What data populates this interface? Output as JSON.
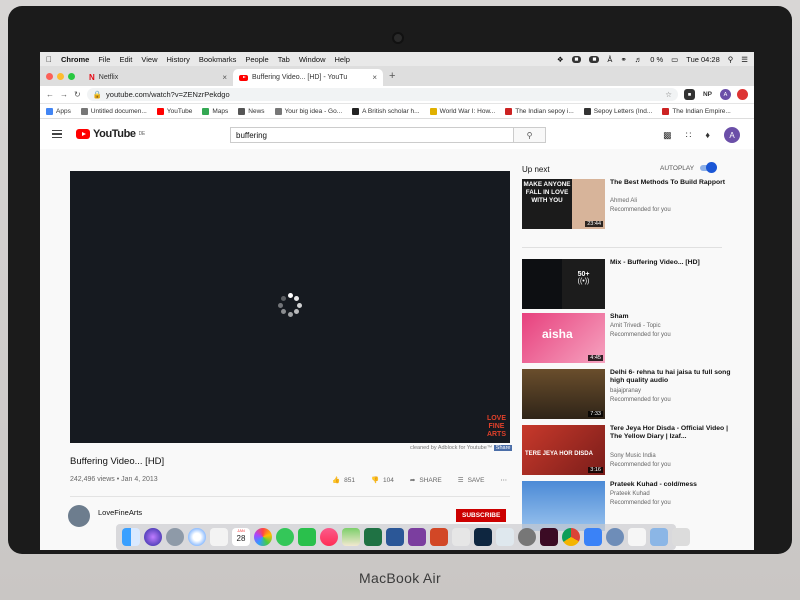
{
  "device": {
    "brand": "MacBook Air"
  },
  "menubar": {
    "app": "Chrome",
    "items": [
      "File",
      "Edit",
      "View",
      "History",
      "Bookmarks",
      "People",
      "Tab",
      "Window",
      "Help"
    ],
    "battery": "0 %",
    "clock": "Tue 04:28"
  },
  "tabs": [
    {
      "label": "Netflix",
      "active": false
    },
    {
      "label": "Buffering Video... [HD] - YouTu",
      "active": true
    }
  ],
  "address": {
    "url": "youtube.com/watch?v=ZENzrPekdgo"
  },
  "extensions": {
    "np": "NP",
    "avatar": "A"
  },
  "bookmarks": [
    {
      "label": "Apps",
      "icon": "apps-grid-icon",
      "color": "#4285f4"
    },
    {
      "label": "Untitled documen...",
      "icon": "doc-icon",
      "color": "#777777"
    },
    {
      "label": "YouTube",
      "icon": "youtube-icon",
      "color": "#ff0000"
    },
    {
      "label": "Maps",
      "icon": "maps-icon",
      "color": "#34a853"
    },
    {
      "label": "News",
      "icon": "news-icon",
      "color": "#555555"
    },
    {
      "label": "Your big idea - Go...",
      "icon": "doc-icon",
      "color": "#777777"
    },
    {
      "label": "A British scholar h...",
      "icon": "quora-icon",
      "color": "#222222"
    },
    {
      "label": "World War I: How...",
      "icon": "site-icon",
      "color": "#e0b000"
    },
    {
      "label": "The Indian sepoy i...",
      "icon": "site-icon",
      "color": "#cc2222"
    },
    {
      "label": "Sepoy Letters (Ind...",
      "icon": "site-icon",
      "color": "#333333"
    },
    {
      "label": "The Indian Empire...",
      "icon": "site-icon",
      "color": "#cc2222"
    }
  ],
  "youtube": {
    "logo": "YouTube",
    "region": "DE",
    "search": {
      "value": "buffering"
    },
    "avatar": "A"
  },
  "video": {
    "title": "Buffering Video... [HD]",
    "views": "242,496 views • Jan 4, 2013",
    "overlay_logo": [
      "LOVE",
      "FINE",
      "ARTS"
    ],
    "adblock_note": "cleaned by Adblock for Youtube™",
    "adblock_badge": "Share",
    "likes": "851",
    "dislikes": "104",
    "share": "SHARE",
    "save": "SAVE",
    "channel": "LoveFineArts",
    "subscribe": "SUBSCRIBE"
  },
  "sidebar": {
    "up_next": "Up next",
    "autoplay": "AUTOPLAY",
    "autoplay_on": true,
    "items": [
      {
        "title": "The Best Methods To Build Rapport",
        "channel": "Ahmed Ali",
        "note": "Recommended for you",
        "duration": "23:44",
        "thumb_text": "MAKE ANYONE FALL IN LOVE WITH YOU"
      },
      {
        "title": "Mix - Buffering Video... [HD]",
        "channel": "",
        "note": "",
        "duration": "",
        "thumb_text": "50+"
      },
      {
        "title": "Sham",
        "channel": "Amit Trivedi - Topic",
        "note": "Recommended for you",
        "duration": "4:45",
        "thumb_text": "aisha"
      },
      {
        "title": "Delhi 6- rehna tu hai jaisa tu full song high quality audio",
        "channel": "bajajpranay",
        "note": "Recommended for you",
        "duration": "7:33",
        "thumb_text": ""
      },
      {
        "title": "Tere Jeya Hor Disda - Official Video | The Yellow Diary | Izaf...",
        "channel": "Sony Music India",
        "note": "Recommended for you",
        "duration": "3:16",
        "thumb_text": "TERE JEYA HOR DISDA"
      },
      {
        "title": "Prateek Kuhad - cold/mess",
        "channel": "Prateek Kuhad",
        "note": "Recommended for you",
        "duration": "",
        "thumb_text": ""
      }
    ]
  },
  "dock": {
    "calendar_day": "28",
    "calendar_month": "JAN",
    "icons": [
      "finder-icon",
      "siri-icon",
      "launchpad-icon",
      "safari-icon",
      "photos-app-icon",
      "calendar-icon",
      "photos-icon",
      "messages-icon",
      "facetime-icon",
      "music-icon",
      "maps-icon",
      "excel-icon",
      "word-icon",
      "onenote-icon",
      "powerpoint-icon",
      "acrobat-icon",
      "photoshop-icon",
      "preview-icon",
      "system-preferences-icon",
      "indesign-icon",
      "chrome-icon",
      "maps-app-icon",
      "quicktime-icon",
      "document-icon",
      "downloads-icon",
      "trash-icon"
    ]
  }
}
